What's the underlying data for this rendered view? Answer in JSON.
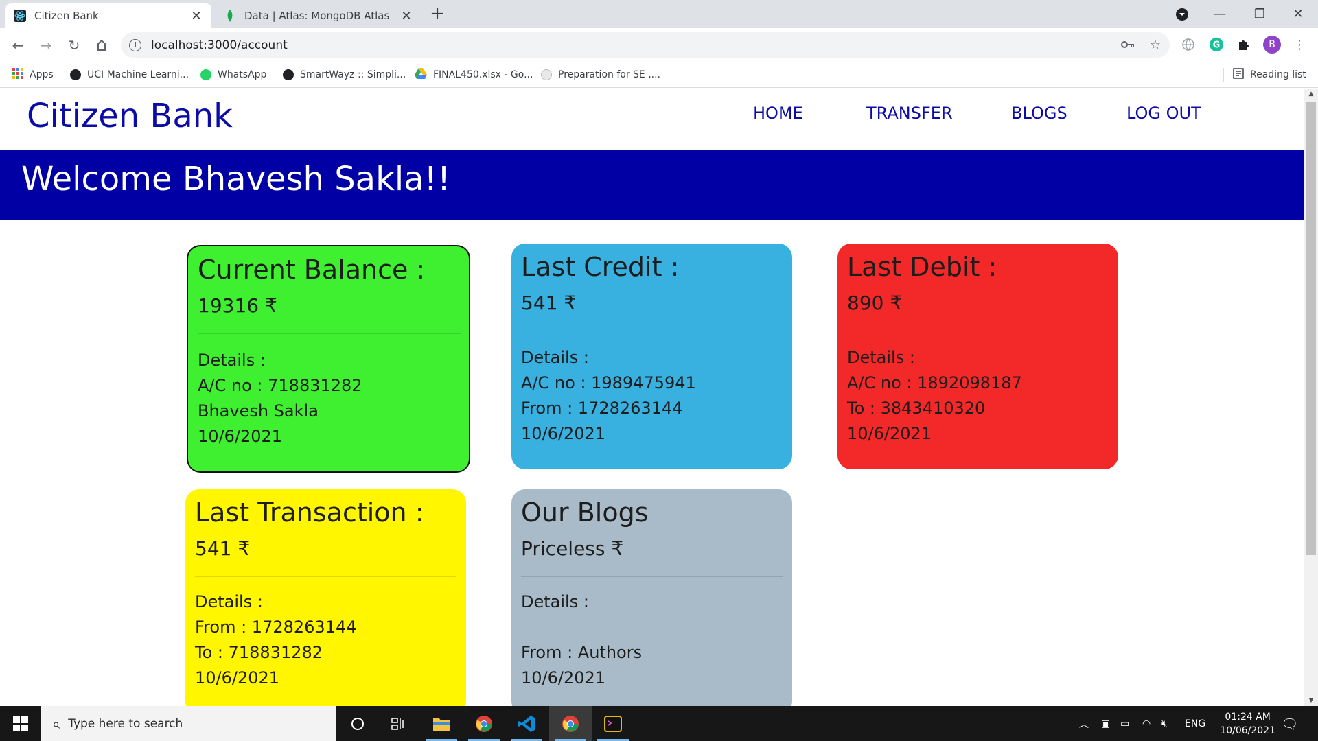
{
  "browser": {
    "tabs": [
      {
        "title": "Citizen Bank",
        "active": true
      },
      {
        "title": "Data | Atlas: MongoDB Atlas",
        "active": false
      }
    ],
    "url": "localhost:3000/account",
    "profile_initial": "B",
    "bookmarks": [
      {
        "label": "Apps",
        "icon": "apps-grid-icon"
      },
      {
        "label": "UCI Machine Learni...",
        "icon": "globe-icon"
      },
      {
        "label": "WhatsApp",
        "icon": "whatsapp-icon"
      },
      {
        "label": "SmartWayz :: Simpli...",
        "icon": "globe-icon"
      },
      {
        "label": "FINAL450.xlsx - Go...",
        "icon": "google-drive-icon"
      },
      {
        "label": "Preparation for SE ,...",
        "icon": "lightbulb-icon"
      }
    ],
    "reading_list": "Reading list"
  },
  "site": {
    "brand": "Citizen Bank",
    "nav": [
      "HOME",
      "TRANSFER",
      "BLOGS",
      "LOG OUT"
    ],
    "welcome": "Welcome Bhavesh Sakla!!"
  },
  "cards": {
    "balance": {
      "heading": "Current Balance :",
      "amount": "19316 ₹",
      "details": "Details :",
      "lines": [
        "A/C no : 718831282",
        "Bhavesh Sakla",
        "10/6/2021"
      ],
      "color": "#3ef030"
    },
    "credit": {
      "heading": "Last Credit :",
      "amount": "541 ₹",
      "details": "Details :",
      "lines": [
        "A/C no : 1989475941",
        "From : 1728263144",
        "10/6/2021"
      ],
      "color": "#38b0e0"
    },
    "debit": {
      "heading": "Last Debit :",
      "amount": "890 ₹",
      "details": "Details :",
      "lines": [
        "A/C no : 1892098187",
        "To : 3843410320",
        "10/6/2021"
      ],
      "color": "#f32828"
    },
    "transaction": {
      "heading": "Last Transaction :",
      "amount": "541 ₹",
      "details": "Details :",
      "lines": [
        "From : 1728263144",
        "To : 718831282",
        "10/6/2021"
      ],
      "color": "#fff600"
    },
    "blogs": {
      "heading": "Our Blogs",
      "amount": "Priceless ₹",
      "details": "Details :",
      "lines": [
        "",
        "From : Authors",
        "10/6/2021"
      ],
      "color": "#a9bbc8"
    }
  },
  "taskbar": {
    "search_placeholder": "Type here to search",
    "language": "ENG",
    "time": "01:24 AM",
    "date": "10/06/2021"
  }
}
